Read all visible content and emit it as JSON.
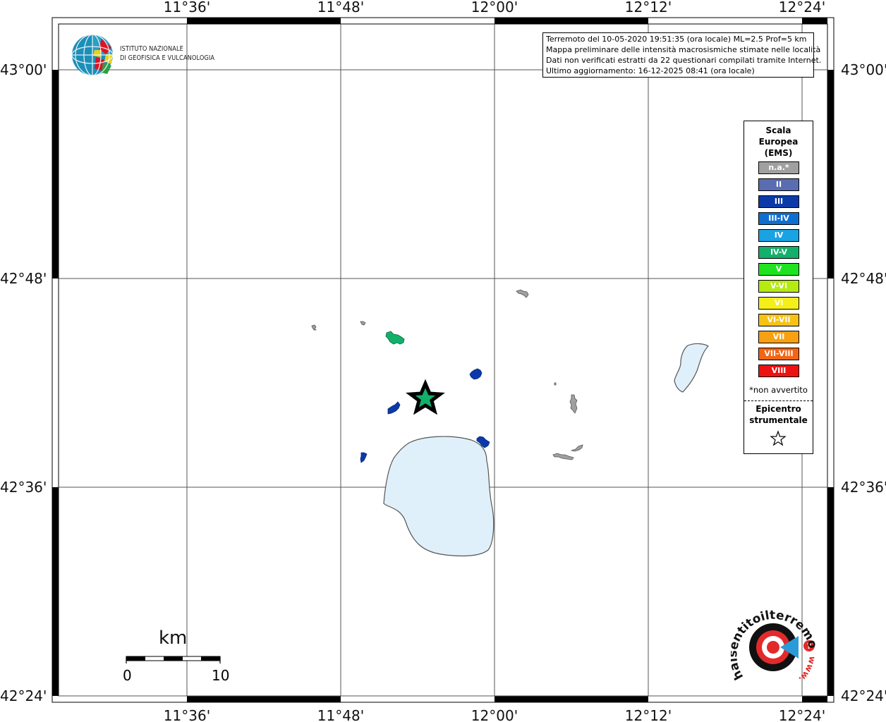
{
  "map": {
    "lon_labels": [
      "11°36'",
      "11°48'",
      "12°00'",
      "12°12'",
      "12°24'"
    ],
    "lat_labels": [
      "43°00'",
      "42°48'",
      "42°36'",
      "42°24'"
    ]
  },
  "info_box": {
    "line1": "Terremoto del 10-05-2020 19:51:35 (ora locale) ML=2.5 Prof=5 km",
    "line2": "Mappa preliminare delle intensità macrosismiche stimate nelle località",
    "line3": "Dati non verificati estratti da 22 questionari compilati tramite Internet.",
    "line4": "Ultimo aggiornamento: 16-12-2025 08:41 (ora locale)"
  },
  "logo": {
    "line1": "ISTITUTO NAZIONALE",
    "line2": "DI GEOFISICA E VULCANOLOGIA"
  },
  "legend": {
    "title": [
      "Scala",
      "Europea",
      "(EMS)"
    ],
    "items": [
      {
        "label": "n.a.*",
        "color": "#a0a0a0"
      },
      {
        "label": "II",
        "color": "#5a6db0"
      },
      {
        "label": "III",
        "color": "#0b3aa8"
      },
      {
        "label": "III-IV",
        "color": "#0f6fd0"
      },
      {
        "label": "IV",
        "color": "#1aa2e3"
      },
      {
        "label": "IV-V",
        "color": "#12b06a"
      },
      {
        "label": "V",
        "color": "#1fe31f"
      },
      {
        "label": "V-VI",
        "color": "#b5ea12"
      },
      {
        "label": "VI",
        "color": "#f4ef1a"
      },
      {
        "label": "VI-VII",
        "color": "#f7c214"
      },
      {
        "label": "VII",
        "color": "#f7a011"
      },
      {
        "label": "VII-VIII",
        "color": "#f46412"
      },
      {
        "label": "VIII",
        "color": "#ee1111"
      }
    ],
    "note": "*non avvertito",
    "epicentre": [
      "Epicentro",
      "strumentale"
    ]
  },
  "scale_bar": {
    "unit": "km",
    "label_start": "0",
    "label_end": "10"
  },
  "watermark": {
    "text": "haisentitoilterremoto.it",
    "www": "www."
  }
}
